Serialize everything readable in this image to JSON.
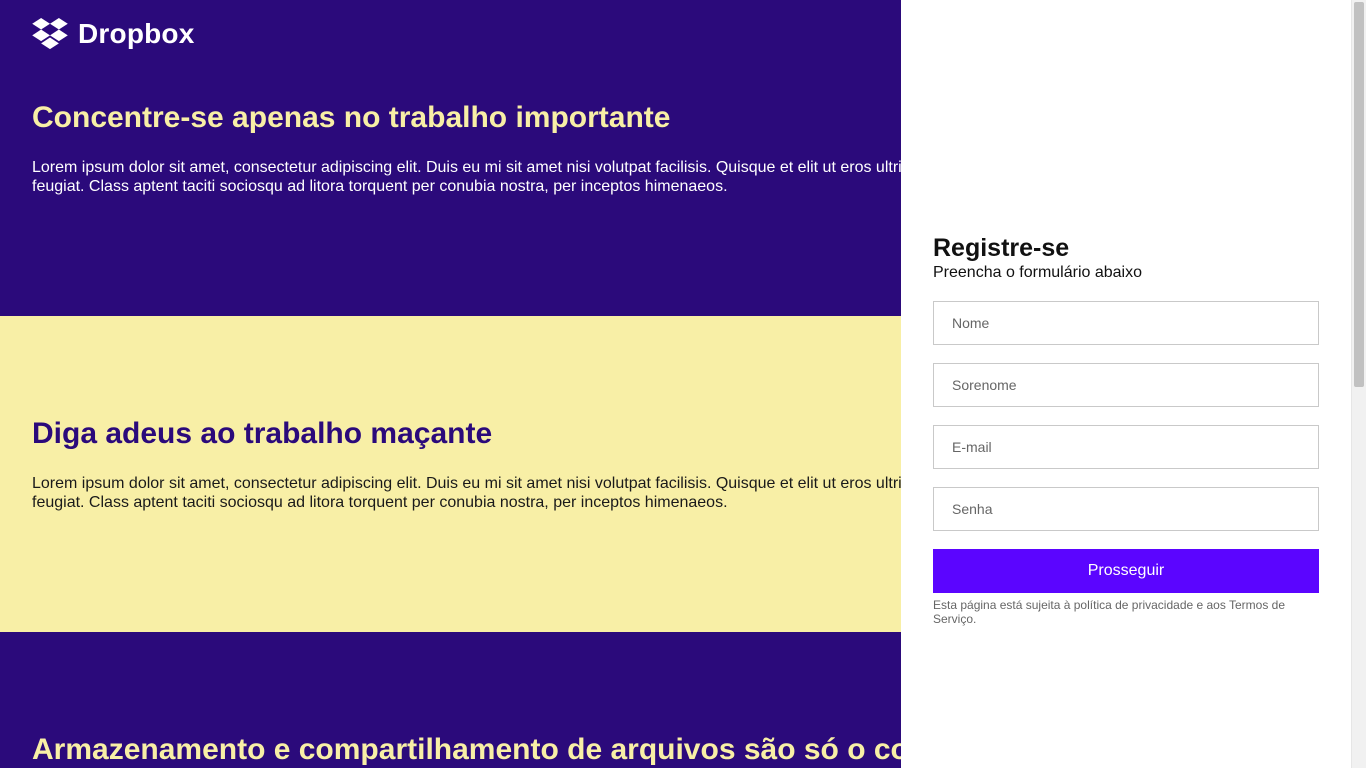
{
  "brand": {
    "name": "Dropbox",
    "icon": "dropbox-logo-icon"
  },
  "colors": {
    "dark": "#2b0a7b",
    "light": "#f8efa6",
    "accent": "#5b05ff",
    "panel": "#ffffff"
  },
  "sections": [
    {
      "title": "Concentre-se apenas no trabalho importante",
      "text": "Lorem ipsum dolor sit amet, consectetur adipiscing elit. Duis eu mi sit amet nisi volutpat facilisis. Quisque et elit ut eros ultrices feugiat. Class aptent taciti sociosqu ad litora torquent per conubia nostra, per inceptos himenaeos."
    },
    {
      "title": "Diga adeus ao trabalho maçante",
      "text": "Lorem ipsum dolor sit amet, consectetur adipiscing elit. Duis eu mi sit amet nisi volutpat facilisis. Quisque et elit ut eros ultrices feugiat. Class aptent taciti sociosqu ad litora torquent per conubia nostra, per inceptos himenaeos."
    },
    {
      "title": "Armazenamento e compartilhamento de arquivos são só o começo"
    }
  ],
  "signup": {
    "title": "Registre-se",
    "subtitle": "Preencha o formulário abaixo",
    "fields": {
      "nome": "Nome",
      "sobrenome": "Sorenome",
      "email": "E-mail",
      "senha": "Senha"
    },
    "submit_label": "Prosseguir",
    "terms": "Esta página está sujeita à política de privacidade e aos Termos de Serviço."
  }
}
